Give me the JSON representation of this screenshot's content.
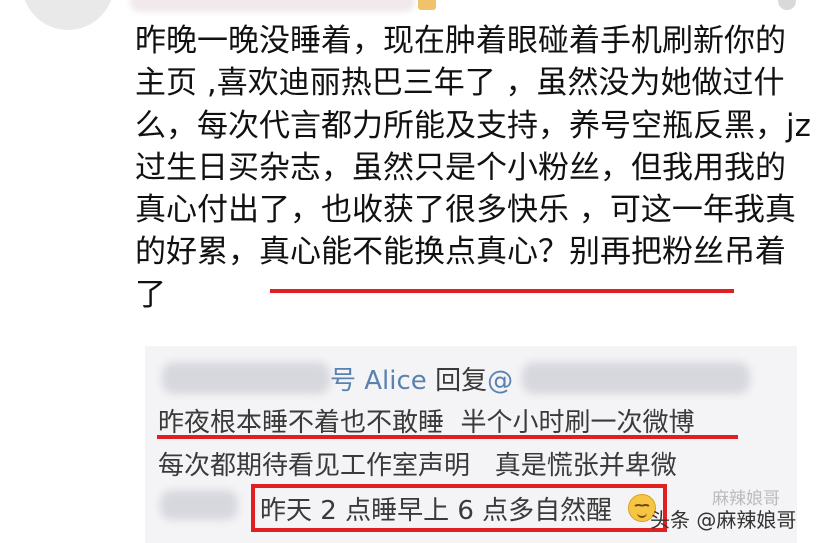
{
  "comment": {
    "text": "昨晚一晚没睡着，现在肿着眼碰着手机刷新你的主页 ,喜欢迪丽热巴三年了 ，虽然没为她做过什么，每次代言都力所能及支持，养号空瓶反黑，jz过生日买杂志，虽然只是个小粉丝，但我用我的真心付出了，也收获了很多快乐 ，可这一年我真的好累，真心能不能换点真心？别再把粉丝吊着了"
  },
  "reply": {
    "header_name_tail": "号 Alice",
    "header_action": "回复",
    "header_at": "@",
    "line1": "昨夜根本睡不着也不敢睡  半个小时刷一次微博",
    "line2": "每次都期待看见工作室声明   真是慌张并卑微",
    "line3": "昨天 2 点睡早上 6 点多自然醒"
  },
  "watermark": {
    "text": "头条 @麻辣娘哥",
    "faint": "麻辣娘哥"
  },
  "icons": {
    "emoji": "smiling-face-icon",
    "watermark_icon": "toutiao-logo-icon"
  },
  "colors": {
    "highlight_red": "#e02020",
    "reply_name_blue": "#5a82b0",
    "reply_bg": "#f4f4f6"
  }
}
